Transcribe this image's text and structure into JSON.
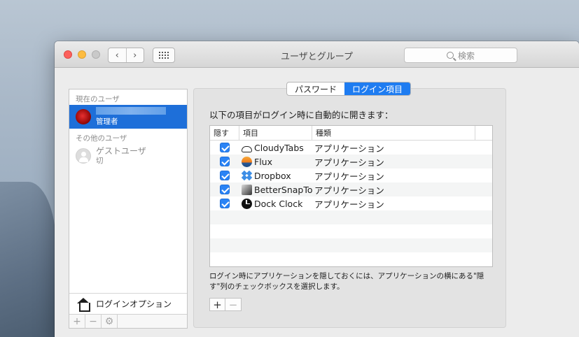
{
  "window": {
    "title": "ユーザとグループ",
    "search_placeholder": "検索"
  },
  "sidebar": {
    "current_users_header": "現在のユーザ",
    "current_user_role": "管理者",
    "other_users_header": "その他のユーザ",
    "guest_name": "ゲストユーザ",
    "guest_status": "切",
    "login_options_label": "ログインオプション"
  },
  "tabs": {
    "password": "パスワード",
    "login_items": "ログイン項目",
    "selected": "login_items"
  },
  "main": {
    "intro": "以下の項目がログイン時に自動的に開きます：",
    "columns": [
      "隠す",
      "項目",
      "種類"
    ],
    "items": [
      {
        "name": "CloudyTabs",
        "kind": "アプリケーション",
        "icon": "cloud-icon",
        "hidden": true
      },
      {
        "name": "Flux",
        "kind": "アプリケーション",
        "icon": "flux-icon",
        "hidden": true
      },
      {
        "name": "Dropbox",
        "kind": "アプリケーション",
        "icon": "dropbox-icon",
        "hidden": true
      },
      {
        "name": "BetterSnapTo",
        "kind": "アプリケーション",
        "icon": "bettersnaptool-icon",
        "hidden": true
      },
      {
        "name": "Dock Clock",
        "kind": "アプリケーション",
        "icon": "clock-icon",
        "hidden": true
      }
    ],
    "note": "ログイン時にアプリケーションを隠しておくには、アプリケーションの横にある\"隠す\"列のチェックボックスを選択します。"
  },
  "colors": {
    "selection": "#1e6fd9",
    "accent": "#1e7cf1",
    "close": "#fc605c",
    "minimize": "#fdbc40"
  }
}
